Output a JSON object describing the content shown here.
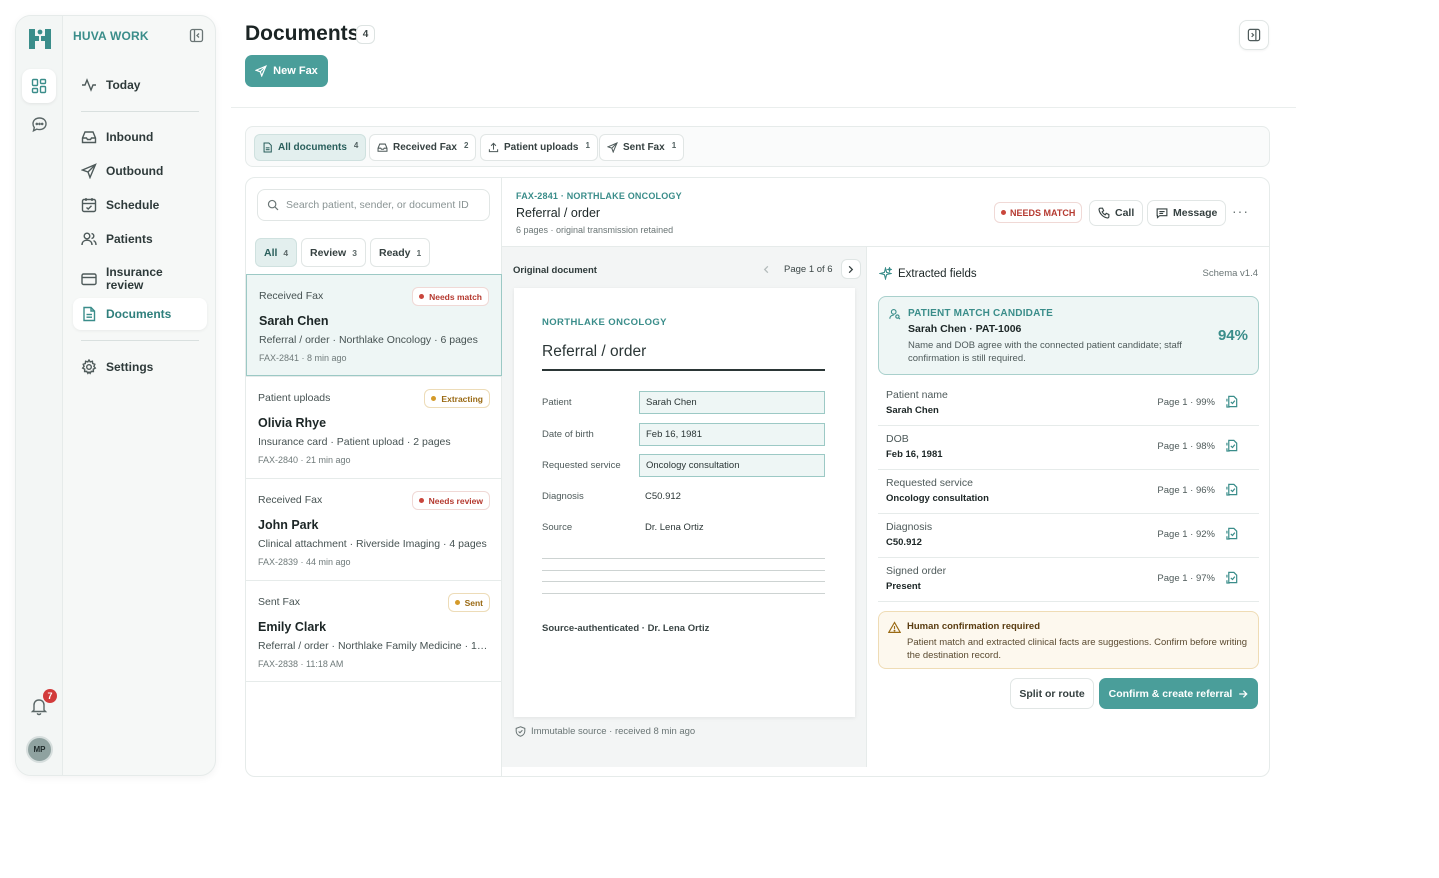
{
  "app": {
    "brand": "HUVA WORK"
  },
  "rail": {
    "notification_count": "7",
    "avatar_initials": "MP"
  },
  "nav": {
    "today": "Today",
    "inbound": "Inbound",
    "outbound": "Outbound",
    "schedule": "Schedule",
    "patients": "Patients",
    "insurance_review": "Insurance review",
    "documents": "Documents",
    "settings": "Settings"
  },
  "header": {
    "title": "Documents",
    "count": "4",
    "new_fax_label": "New Fax"
  },
  "filters": [
    {
      "label": "All documents",
      "count": "4"
    },
    {
      "label": "Received Fax",
      "count": "2"
    },
    {
      "label": "Patient uploads",
      "count": "1"
    },
    {
      "label": "Sent Fax",
      "count": "1"
    }
  ],
  "list": {
    "search_placeholder": "Search patient, sender, or document ID",
    "segments": [
      {
        "label": "All",
        "count": "4"
      },
      {
        "label": "Review",
        "count": "3"
      },
      {
        "label": "Ready",
        "count": "1"
      }
    ],
    "items": [
      {
        "source": "Received Fax",
        "status": "Needs match",
        "name": "Sarah Chen",
        "desc": "Referral / order · Northlake Oncology · 6 pages",
        "meta": "FAX-2841 · 8 min ago"
      },
      {
        "source": "Patient uploads",
        "status": "Extracting",
        "name": "Olivia Rhye",
        "desc": "Insurance card · Patient upload · 2 pages",
        "meta": "FAX-2840 · 21 min ago"
      },
      {
        "source": "Received Fax",
        "status": "Needs review",
        "name": "John Park",
        "desc": "Clinical attachment · Riverside Imaging · 4 pages",
        "meta": "FAX-2839 · 44 min ago"
      },
      {
        "source": "Sent Fax",
        "status": "Sent",
        "name": "Emily Clark",
        "desc": "Referral / order · Northlake Family Medicine · 1 p...",
        "meta": "FAX-2838 · 11:18 AM"
      }
    ]
  },
  "detail": {
    "id_line": "FAX-2841 · NORTHLAKE ONCOLOGY",
    "title": "Referral / order",
    "subtitle": "6 pages · original transmission retained",
    "status": "NEEDS MATCH",
    "call_label": "Call",
    "message_label": "Message",
    "more": "···"
  },
  "viewer": {
    "label": "Original document",
    "page_indicator": "Page 1 of 6",
    "org": "NORTHLAKE ONCOLOGY",
    "doc_title": "Referral / order",
    "fields": [
      {
        "label": "Patient",
        "value": "Sarah Chen"
      },
      {
        "label": "Date of birth",
        "value": "Feb 16, 1981"
      },
      {
        "label": "Requested service",
        "value": "Oncology consultation"
      },
      {
        "label": "Diagnosis",
        "value": "C50.912"
      },
      {
        "label": "Source",
        "value": "Dr. Lena Ortiz"
      }
    ],
    "signature": "Source-authenticated · Dr. Lena Ortiz",
    "immutable_note": "Immutable source · received 8 min ago"
  },
  "extracted": {
    "title": "Extracted fields",
    "schema": "Schema v1.4",
    "match": {
      "heading": "PATIENT MATCH CANDIDATE",
      "name": "Sarah Chen · PAT-1006",
      "description": "Name and DOB agree with the connected patient candidate; staff confirmation is still required.",
      "confidence": "94%"
    },
    "rows": [
      {
        "label": "Patient name",
        "value": "Sarah Chen",
        "meta": "Page 1 · 99%"
      },
      {
        "label": "DOB",
        "value": "Feb 16, 1981",
        "meta": "Page 1 · 98%"
      },
      {
        "label": "Requested service",
        "value": "Oncology consultation",
        "meta": "Page 1 · 96%"
      },
      {
        "label": "Diagnosis",
        "value": "C50.912",
        "meta": "Page 1 · 92%"
      },
      {
        "label": "Signed order",
        "value": "Present",
        "meta": "Page 1 · 97%"
      }
    ],
    "warning": {
      "title": "Human confirmation required",
      "description": "Patient match and extracted clinical facts are suggestions. Confirm before writing the destination record."
    },
    "split_label": "Split or route",
    "confirm_label": "Confirm & create referral"
  },
  "colors": {
    "accent": "#4a9e9a",
    "accent_text": "#3a8d8a",
    "danger": "#d23b3b",
    "warning_bg": "#fdf8ee"
  }
}
